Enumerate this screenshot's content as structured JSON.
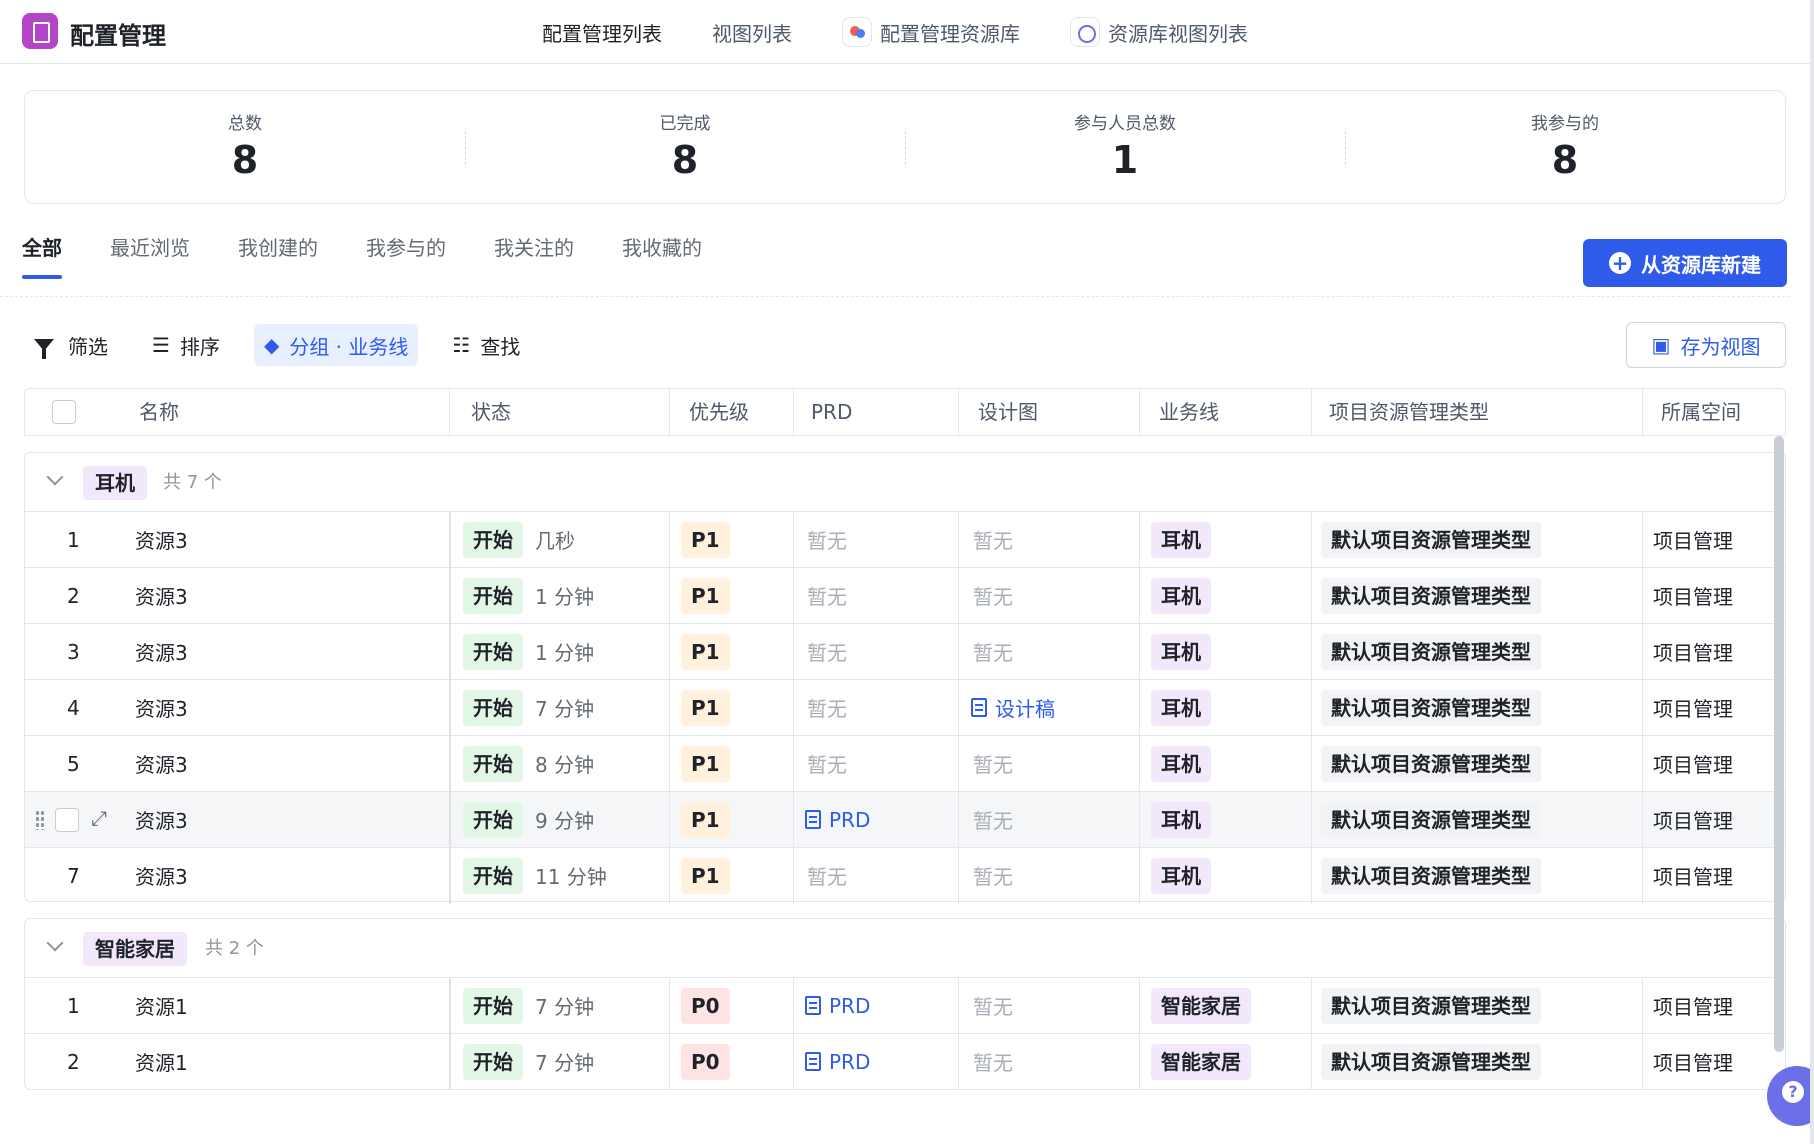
{
  "header": {
    "app_title": "配置管理",
    "nav": [
      "配置管理列表",
      "视图列表",
      "配置管理资源库",
      "资源库视图列表"
    ]
  },
  "stats": [
    {
      "label": "总数",
      "value": "8"
    },
    {
      "label": "已完成",
      "value": "8"
    },
    {
      "label": "参与人员总数",
      "value": "1"
    },
    {
      "label": "我参与的",
      "value": "8"
    }
  ],
  "tabs": [
    "全部",
    "最近浏览",
    "我创建的",
    "我参与的",
    "我关注的",
    "我收藏的"
  ],
  "new_button": "从资源库新建",
  "toolbar": {
    "filter": "筛选",
    "sort": "排序",
    "group": "分组 · 业务线",
    "find": "查找",
    "save_view": "存为视图"
  },
  "columns": [
    "名称",
    "状态",
    "优先级",
    "PRD",
    "设计图",
    "业务线",
    "项目资源管理类型",
    "所属空间"
  ],
  "groups": [
    {
      "name": "耳机",
      "count_text": "共 7 个",
      "rows": [
        {
          "index": "1",
          "name": "资源3",
          "status": "开始",
          "time": "几秒",
          "priority": "P1",
          "prd": "暂无",
          "design": "暂无",
          "biz": "耳机",
          "type": "默认项目资源管理类型",
          "space": "项目管理"
        },
        {
          "index": "2",
          "name": "资源3",
          "status": "开始",
          "time": "1 分钟",
          "priority": "P1",
          "prd": "暂无",
          "design": "暂无",
          "biz": "耳机",
          "type": "默认项目资源管理类型",
          "space": "项目管理"
        },
        {
          "index": "3",
          "name": "资源3",
          "status": "开始",
          "time": "1 分钟",
          "priority": "P1",
          "prd": "暂无",
          "design": "暂无",
          "biz": "耳机",
          "type": "默认项目资源管理类型",
          "space": "项目管理"
        },
        {
          "index": "4",
          "name": "资源3",
          "status": "开始",
          "time": "7 分钟",
          "priority": "P1",
          "prd": "暂无",
          "design": "设计稿",
          "biz": "耳机",
          "type": "默认项目资源管理类型",
          "space": "项目管理"
        },
        {
          "index": "5",
          "name": "资源3",
          "status": "开始",
          "time": "8 分钟",
          "priority": "P1",
          "prd": "暂无",
          "design": "暂无",
          "biz": "耳机",
          "type": "默认项目资源管理类型",
          "space": "项目管理"
        },
        {
          "index": "",
          "name": "资源3",
          "status": "开始",
          "time": "9 分钟",
          "priority": "P1",
          "prd": "PRD",
          "design": "暂无",
          "biz": "耳机",
          "type": "默认项目资源管理类型",
          "space": "项目管理"
        },
        {
          "index": "7",
          "name": "资源3",
          "status": "开始",
          "time": "11 分钟",
          "priority": "P1",
          "prd": "暂无",
          "design": "暂无",
          "biz": "耳机",
          "type": "默认项目资源管理类型",
          "space": "项目管理"
        }
      ]
    },
    {
      "name": "智能家居",
      "count_text": "共 2 个",
      "rows": [
        {
          "index": "1",
          "name": "资源1",
          "status": "开始",
          "time": "7 分钟",
          "priority": "P0",
          "prd": "PRD",
          "design": "暂无",
          "biz": "智能家居",
          "type": "默认项目资源管理类型",
          "space": "项目管理"
        },
        {
          "index": "2",
          "name": "资源1",
          "status": "开始",
          "time": "7 分钟",
          "priority": "P0",
          "prd": "PRD",
          "design": "暂无",
          "biz": "智能家居",
          "type": "默认项目资源管理类型",
          "space": "项目管理"
        }
      ]
    }
  ],
  "colors": {
    "accent": "#2f5bea",
    "logo": "#b445c8",
    "status_bg": "#e3f7e6",
    "p1_bg": "#fff1dc",
    "p0_bg": "#ffe4e6",
    "biz_bg": "#f3e8fb"
  }
}
